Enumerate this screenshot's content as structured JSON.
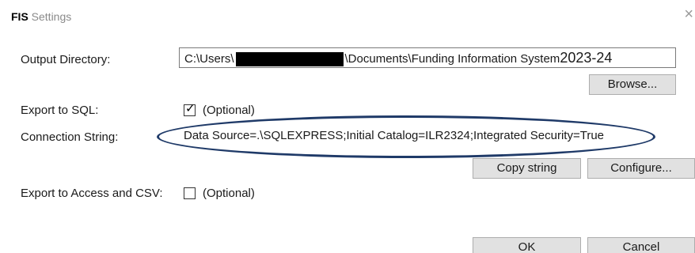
{
  "window": {
    "title_app": "FIS",
    "title_rest": " Settings",
    "close_glyph": "×"
  },
  "output_directory": {
    "label": "Output Directory:",
    "path_prefix": "C:\\Users\\",
    "path_suffix": "\\Documents\\Funding Information System",
    "path_year": "2023-24",
    "browse_label": "Browse..."
  },
  "export_sql": {
    "label": "Export to SQL:",
    "checked": true,
    "check_glyph": "✓",
    "optional_text": "(Optional)"
  },
  "connection": {
    "label": "Connection String:",
    "prefix": "Data Source=.\\SQLEXPRESS;Initial Catalog=",
    "catalog": "ILR2324",
    "suffix": ";Integrated Security=True",
    "copy_label": "Copy string",
    "configure_label": "Configure...",
    "highlight_color": "#1f3a68"
  },
  "export_access_csv": {
    "label": "Export to Access and CSV:",
    "checked": false,
    "optional_text": "(Optional)"
  },
  "footer": {
    "ok_label": "OK",
    "cancel_label": "Cancel"
  }
}
